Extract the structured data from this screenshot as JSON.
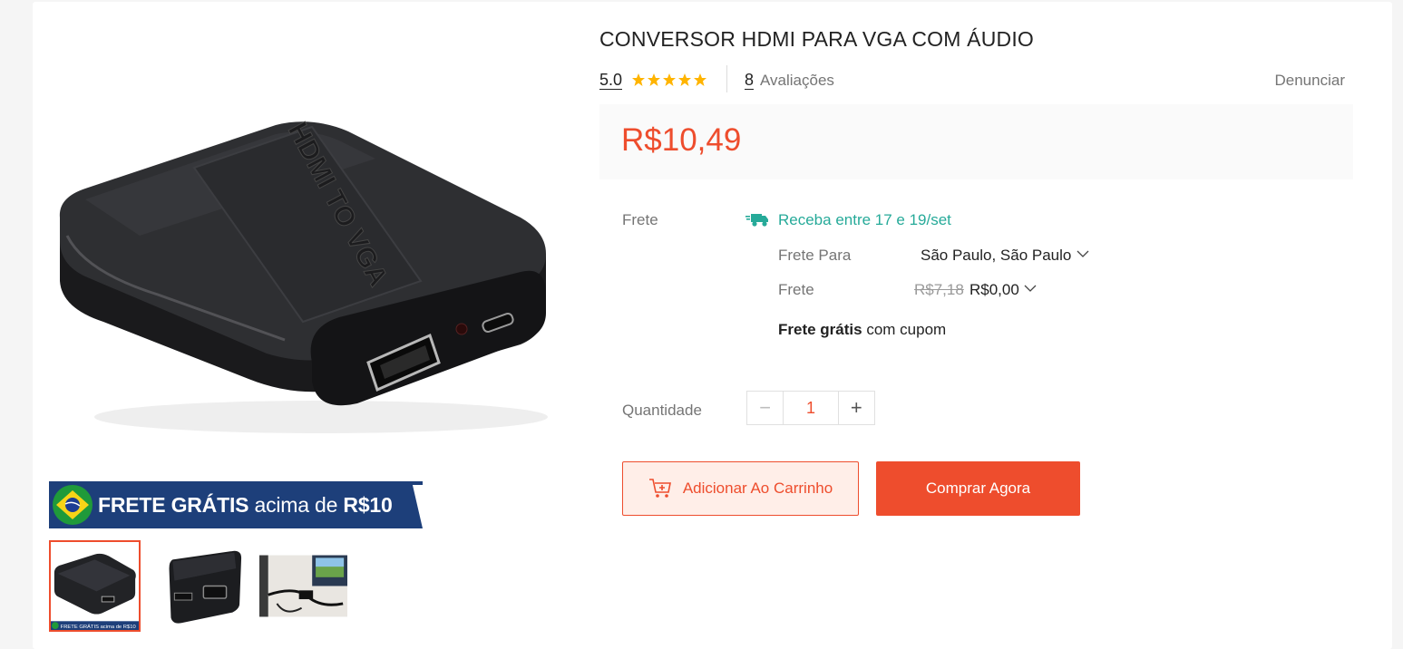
{
  "product": {
    "title": "CONVERSOR HDMI PARA VGA COM ÁUDIO",
    "device_label": "HDMI TO VGA",
    "rating": "5.0",
    "stars": 5,
    "review_count": "8",
    "review_label": "Avaliações",
    "report_label": "Denunciar",
    "price": "R$10,49"
  },
  "promo": {
    "text_bold_1": "FRETE GRÁTIS",
    "text_light": "acima de",
    "text_bold_2": "R$10"
  },
  "shipping": {
    "label": "Frete",
    "eta": "Receba entre 17 e 19/set",
    "to_label": "Frete Para",
    "to_value": "São Paulo, São Paulo",
    "fee_label": "Frete",
    "old_fee": "R$7,18",
    "new_fee": "R$0,00",
    "free_bold": "Frete grátis",
    "free_rest": "com cupom"
  },
  "quantity": {
    "label": "Quantidade",
    "value": "1",
    "minus": "−",
    "plus": "+"
  },
  "actions": {
    "add_to_cart": "Adicionar Ao Carrinho",
    "buy_now": "Comprar Agora"
  },
  "colors": {
    "accent": "#ee4d2d",
    "teal": "#26aa99",
    "star": "#ffb400",
    "banner_blue": "#1d3f7a"
  }
}
